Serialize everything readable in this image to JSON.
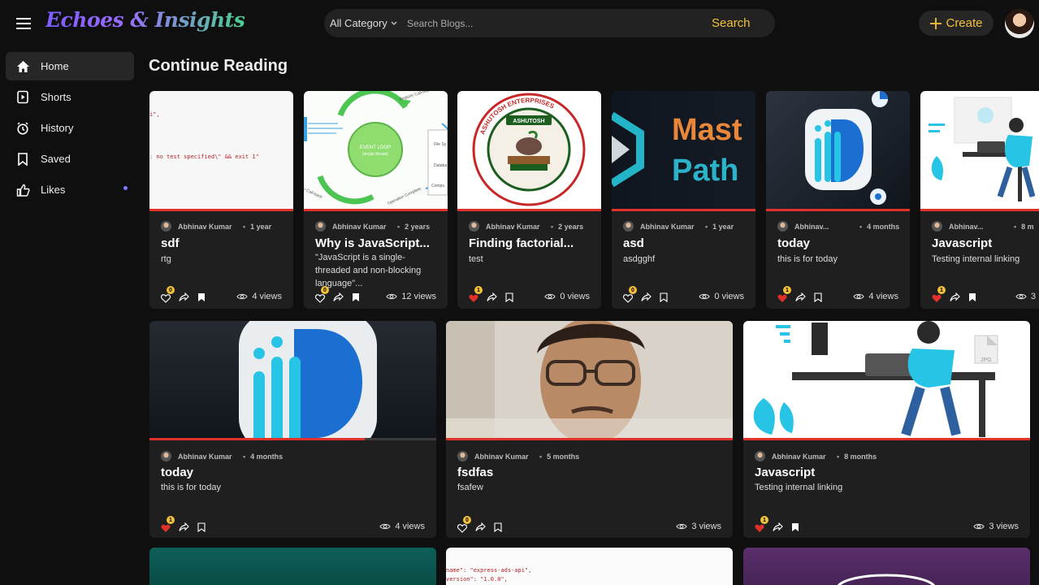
{
  "header": {
    "logo": "Echoes & Insights",
    "category_label": "All Category",
    "search_placeholder": "Search Blogs...",
    "search_button": "Search",
    "create_label": "Create"
  },
  "sidebar": {
    "items": [
      {
        "label": "Home",
        "icon": "home-icon",
        "active": true
      },
      {
        "label": "Shorts",
        "icon": "shorts-icon"
      },
      {
        "label": "History",
        "icon": "history-icon"
      },
      {
        "label": "Saved",
        "icon": "bookmark-icon"
      },
      {
        "label": "Likes",
        "icon": "thumbs-up-icon",
        "notification_dot": true
      }
    ]
  },
  "main": {
    "section_title": "Continue Reading",
    "row1": [
      {
        "author": "Abhinav Kumar",
        "time": "1 year",
        "title": "sdf",
        "desc": "rtg",
        "likes": "0",
        "liked": false,
        "saved": true,
        "views": "4 views",
        "progress": 1.0
      },
      {
        "author": "Abhinav Kumar",
        "time": "2 years",
        "title": "Why is JavaScript...",
        "desc": "\"JavaScript is a single-threaded and non-blocking language\"...",
        "likes": "0",
        "liked": false,
        "saved": true,
        "views": "12 views",
        "progress": 1.0
      },
      {
        "author": "Abhinav Kumar",
        "time": "2 years",
        "title": "Finding factorial...",
        "desc": "test",
        "likes": "1",
        "liked": true,
        "saved": false,
        "views": "0 views",
        "progress": 1.0
      },
      {
        "author": "Abhinav Kumar",
        "time": "1 year",
        "title": "asd",
        "desc": "asdgghf",
        "likes": "0",
        "liked": false,
        "saved": false,
        "views": "0 views",
        "progress": 1.0
      },
      {
        "author": "Abhinav...",
        "time": "4 months",
        "title": "today",
        "desc": "this is for today",
        "likes": "1",
        "liked": true,
        "saved": false,
        "views": "4 views",
        "progress": 1.0
      },
      {
        "author": "Abhinav...",
        "time": "8 m",
        "title": "Javascript",
        "desc": "Testing internal linking",
        "likes": "1",
        "liked": true,
        "saved": true,
        "views": "3",
        "progress": 1.0
      }
    ],
    "row2": [
      {
        "author": "Abhinav Kumar",
        "time": "4 months",
        "title": "today",
        "desc": "this is for today",
        "likes": "1",
        "liked": true,
        "saved": false,
        "views": "4 views",
        "progress": 0.75
      },
      {
        "author": "Abhinav Kumar",
        "time": "5 months",
        "title": "fsdfas",
        "desc": "fsafew",
        "likes": "0",
        "liked": false,
        "saved": false,
        "views": "3 views",
        "progress": 1.0
      },
      {
        "author": "Abhinav Kumar",
        "time": "8 months",
        "title": "Javascript",
        "desc": "Testing internal linking",
        "likes": "1",
        "liked": true,
        "saved": true,
        "views": "3 views",
        "progress": 1.0
      }
    ],
    "thumb_texts": {
      "code1_a": "i\",",
      "code1_b": ": no test specified\\\" && exit 1\"",
      "loop_register": "Register Call-back",
      "loop_center": "EVENT LOOP",
      "loop_center_sub": "(single thread)",
      "loop_op": "Operation Complete",
      "loop_callback": "r Call-back",
      "loop_file": "File Sy",
      "loop_db": "Databa",
      "loop_comp": "Compu",
      "seal_ring": "ASHUTOSH ENTERPRISES",
      "seal_center": "ASHUTOSH",
      "master_line1": "Mast",
      "master_line2": "Path",
      "jpg": "JPG",
      "code3_a": "name\": \"express-ads-api\",",
      "code3_b": "version\": \"1.0.0\","
    }
  },
  "colors": {
    "accent": "#f3c13a",
    "progress": "#e0312b",
    "like": "#e0312b"
  }
}
